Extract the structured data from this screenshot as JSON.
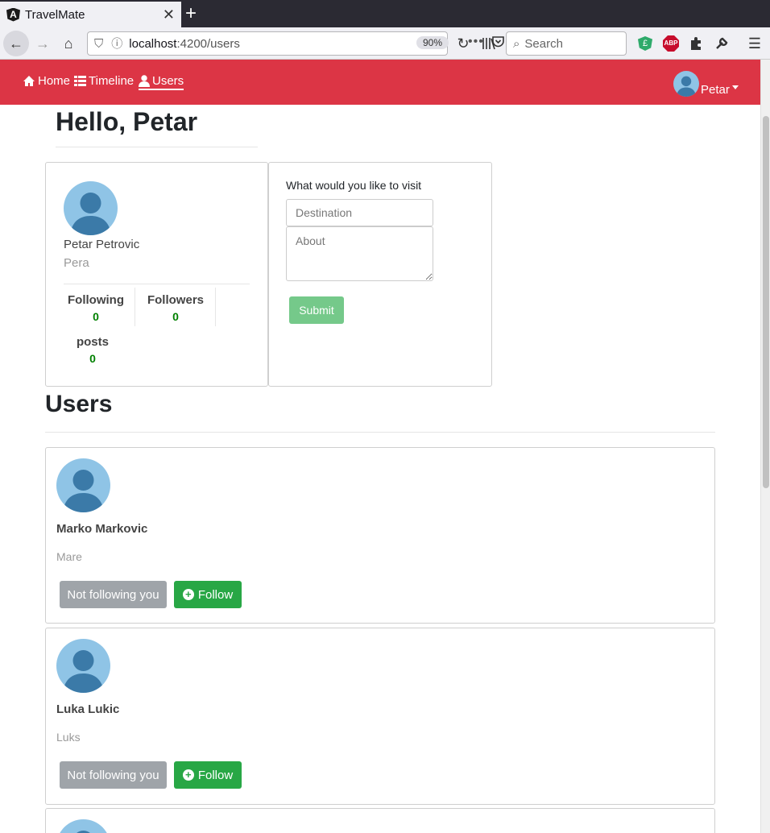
{
  "browser": {
    "tab_title": "TravelMate",
    "url_host": "localhost",
    "url_path": ":4200/users",
    "zoom": "90%",
    "search_placeholder": "Search",
    "abp_label": "ABP"
  },
  "app_nav": {
    "home": "Home",
    "timeline": "Timeline",
    "users": "Users",
    "user_menu": "Petar"
  },
  "greeting": "Hello, Petar",
  "profile": {
    "name": "Petar Petrovic",
    "nickname": "Pera",
    "following_label": "Following",
    "following_count": "0",
    "followers_label": "Followers",
    "followers_count": "0",
    "posts_label": "posts",
    "posts_count": "0"
  },
  "post_form": {
    "label": "What would you like to visit",
    "destination_placeholder": "Destination",
    "about_placeholder": "About",
    "submit": "Submit"
  },
  "users_section": {
    "title": "Users",
    "users": [
      {
        "name": "Marko Markovic",
        "nickname": "Mare",
        "status": "Not following you",
        "action": "Follow"
      },
      {
        "name": "Luka Lukic",
        "nickname": "Luks",
        "status": "Not following you",
        "action": "Follow"
      }
    ]
  },
  "colors": {
    "navbar": "#dc3545",
    "follow": "#28a745",
    "stat_number": "#008000"
  }
}
